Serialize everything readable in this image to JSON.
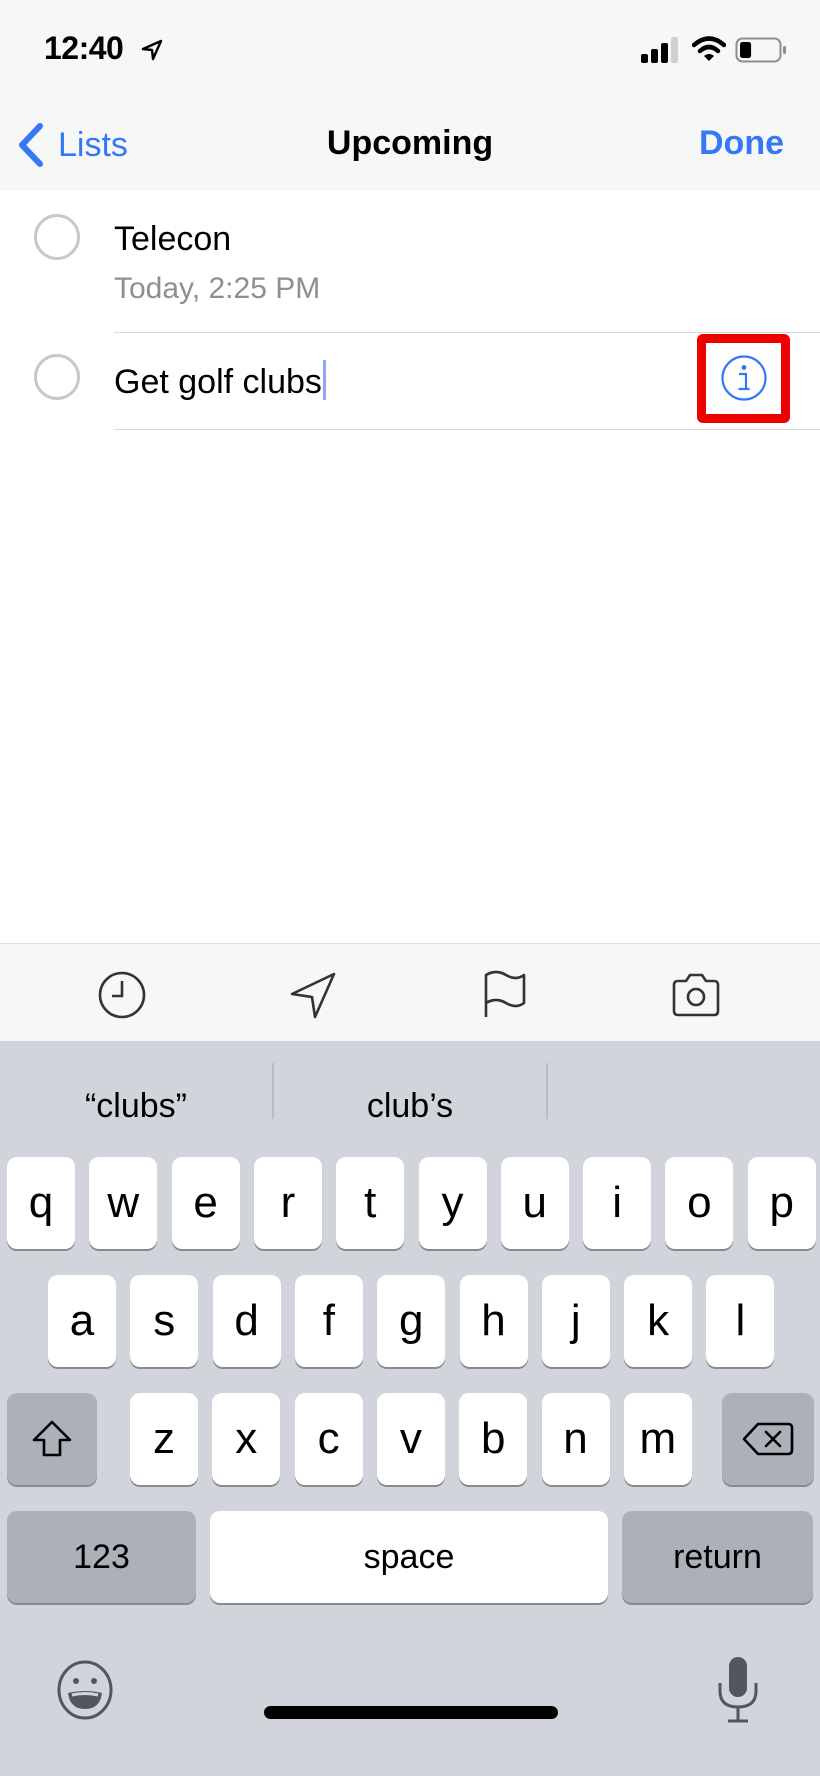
{
  "status_bar": {
    "time": "12:40",
    "location_icon": "location-arrow-icon",
    "signal_bars_active": 3,
    "signal_bars_total": 4,
    "wifi_icon": "wifi-icon",
    "battery_level_fraction": 0.3
  },
  "nav": {
    "back_label": "Lists",
    "title": "Upcoming",
    "done_label": "Done",
    "accent_color": "#3478f6"
  },
  "reminders": [
    {
      "title": "Telecon",
      "subtitle": "Today, 2:25 PM"
    },
    {
      "title": "Get golf clubs",
      "editing": true
    }
  ],
  "highlight": {
    "target": "info-button",
    "color": "#ee0000"
  },
  "accessory_toolbar": [
    {
      "name": "clock-icon",
      "label": "Time"
    },
    {
      "name": "location-icon",
      "label": "Location"
    },
    {
      "name": "flag-icon",
      "label": "Flag"
    },
    {
      "name": "camera-icon",
      "label": "Camera"
    }
  ],
  "keyboard": {
    "suggestions": [
      "“clubs”",
      "club’s",
      ""
    ],
    "row1": [
      "q",
      "w",
      "e",
      "r",
      "t",
      "y",
      "u",
      "i",
      "o",
      "p"
    ],
    "row2": [
      "a",
      "s",
      "d",
      "f",
      "g",
      "h",
      "j",
      "k",
      "l"
    ],
    "row3": [
      "z",
      "x",
      "c",
      "v",
      "b",
      "n",
      "m"
    ],
    "numbers_label": "123",
    "space_label": "space",
    "return_label": "return",
    "shift_icon": "shift-icon",
    "delete_icon": "delete-icon",
    "emoji_icon": "emoji-icon",
    "mic_icon": "microphone-icon"
  }
}
